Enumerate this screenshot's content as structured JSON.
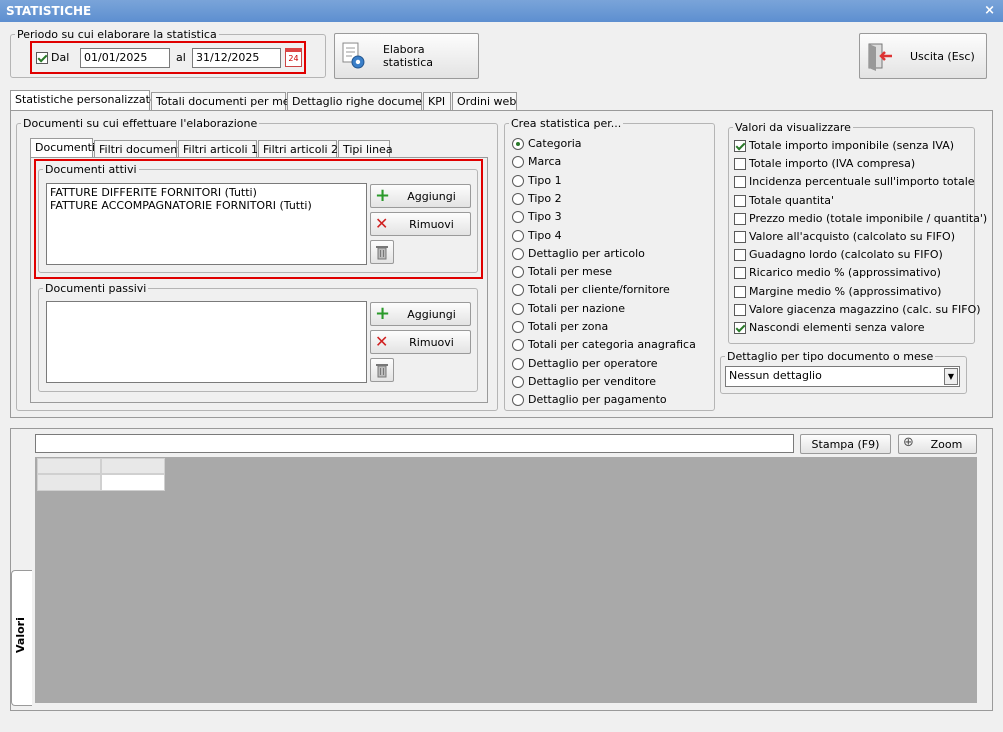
{
  "window": {
    "title": "STATISTICHE",
    "close_symbol": "×"
  },
  "period": {
    "legend": "Periodo su cui elaborare la statistica",
    "dal_label": "Dal",
    "dal_checked": true,
    "from_value": "01/01/2025",
    "al_label": "al",
    "to_value": "31/12/2025",
    "calendar_day": "24"
  },
  "buttons": {
    "elabora": "Elabora statistica",
    "uscita": "Uscita (Esc)"
  },
  "main_tabs": [
    "Statistiche personalizzate",
    "Totali documenti per mese",
    "Dettaglio righe documenti",
    "KPI",
    "Ordini web"
  ],
  "documents": {
    "legend": "Documenti su cui effettuare l'elaborazione",
    "sub_tabs": [
      "Documenti",
      "Filtri documenti",
      "Filtri articoli 1",
      "Filtri articoli 2",
      "Tipi linea"
    ],
    "active": {
      "legend": "Documenti attivi",
      "items": [
        "FATTURE DIFFERITE FORNITORI (Tutti)",
        "FATTURE ACCOMPAGNATORIE FORNITORI (Tutti)"
      ],
      "add_label": "Aggiungi",
      "remove_label": "Rimuovi"
    },
    "passive": {
      "legend": "Documenti passivi",
      "items": [],
      "add_label": "Aggiungi",
      "remove_label": "Rimuovi"
    }
  },
  "crea": {
    "legend": "Crea statistica per...",
    "selected": 0,
    "options": [
      "Categoria",
      "Marca",
      "Tipo 1",
      "Tipo 2",
      "Tipo 3",
      "Tipo 4",
      "Dettaglio per articolo",
      "Totali per mese",
      "Totali per cliente/fornitore",
      "Totali per nazione",
      "Totali per zona",
      "Totali per categoria anagrafica",
      "Dettaglio per operatore",
      "Dettaglio per venditore",
      "Dettaglio per pagamento"
    ]
  },
  "valori": {
    "legend": "Valori da visualizzare",
    "items": [
      {
        "label": "Totale importo imponibile (senza IVA)",
        "checked": true
      },
      {
        "label": "Totale importo (IVA compresa)",
        "checked": false
      },
      {
        "label": "Incidenza percentuale sull'importo totale",
        "checked": false
      },
      {
        "label": "Totale quantita'",
        "checked": false
      },
      {
        "label": "Prezzo medio (totale imponibile / quantita')",
        "checked": false
      },
      {
        "label": "Valore all'acquisto (calcolato su FIFO)",
        "checked": false
      },
      {
        "label": "Guadagno lordo (calcolato su FIFO)",
        "checked": false
      },
      {
        "label": "Ricarico medio % (approssimativo)",
        "checked": false
      },
      {
        "label": "Margine medio % (approssimativo)",
        "checked": false
      },
      {
        "label": "Valore giacenza magazzino (calc. su FIFO)",
        "checked": false
      },
      {
        "label": "Nascondi elementi senza valore",
        "checked": true
      }
    ]
  },
  "dettaglio": {
    "legend": "Dettaglio per tipo documento o mese",
    "selected": "Nessun dettaglio"
  },
  "results": {
    "filter_value": "",
    "stampa_label": "Stampa (F9)",
    "zoom_label": "Zoom",
    "side_tab": "Valori"
  },
  "colors": {
    "titlebar": "#6a98d6",
    "highlight_red": "#e00000",
    "grid_bg": "#a9a9a9"
  }
}
